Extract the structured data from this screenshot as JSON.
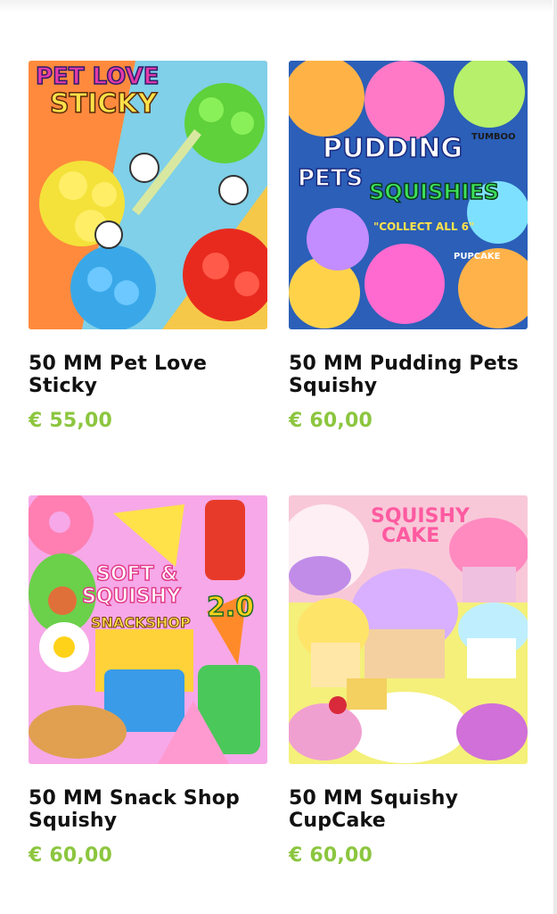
{
  "products": [
    {
      "name": "50 MM Pet Love Sticky",
      "price": "€ 55,00",
      "image_text": "PET LOVE STICKY"
    },
    {
      "name": "50 MM Pudding Pets Squishy",
      "price": "€ 60,00",
      "image_text": "PUDDING PETS SQUISHIES"
    },
    {
      "name": "50 MM Snack Shop Squishy",
      "price": "€ 60,00",
      "image_text": "SOFT & SQUISHY SNACKSHOP 2.0"
    },
    {
      "name": "50 MM Squishy CupCake",
      "price": "€ 60,00",
      "image_text": "SQUISHY CAKE"
    }
  ],
  "colors": {
    "price": "#8cc63f",
    "text": "#111111"
  }
}
